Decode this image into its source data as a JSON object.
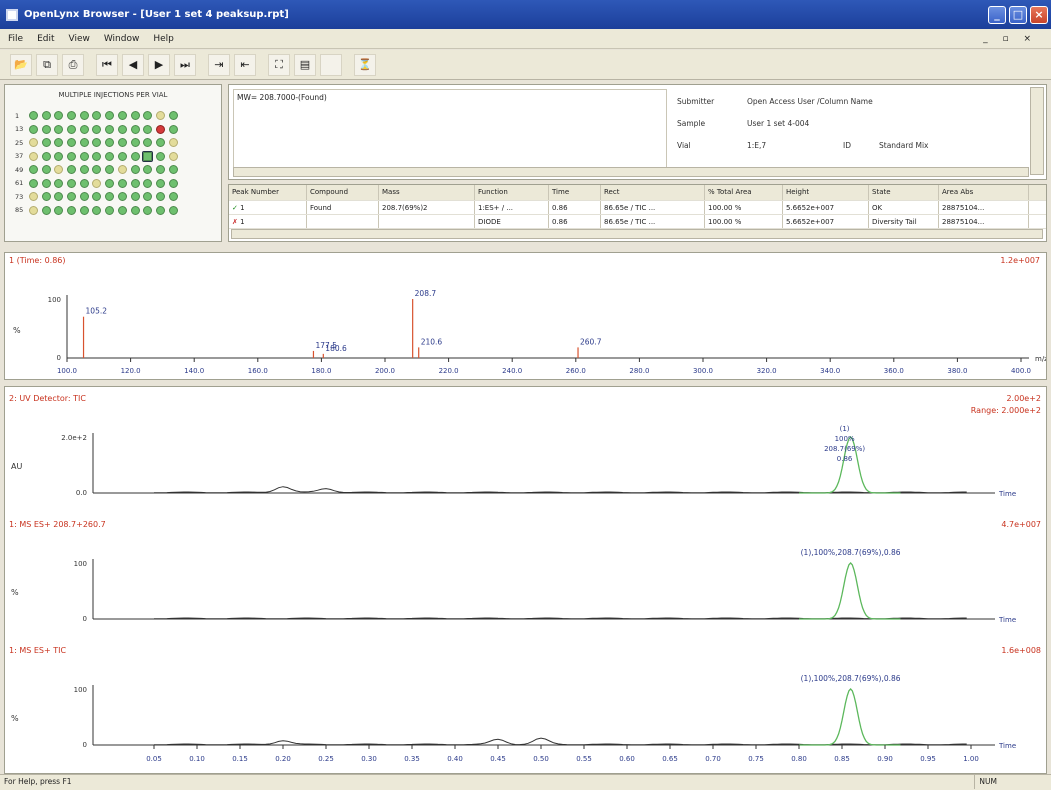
{
  "window": {
    "title": "OpenLynx Browser - [User 1 set 4 peaksup.rpt]",
    "min_glyph": "_",
    "max_glyph": "□",
    "close_glyph": "×"
  },
  "menu": {
    "items": [
      "File",
      "Edit",
      "View",
      "Window",
      "Help"
    ],
    "mdi_controls": "_ ▫ ×"
  },
  "toolbar": {
    "buttons": [
      {
        "name": "open-icon",
        "glyph": "📂"
      },
      {
        "name": "copy-icon",
        "glyph": "⧉"
      },
      {
        "name": "print-icon",
        "glyph": "⎙"
      },
      {
        "name": "first-icon",
        "glyph": "⏮"
      },
      {
        "name": "prev-icon",
        "glyph": "◀"
      },
      {
        "name": "next-icon",
        "glyph": "▶"
      },
      {
        "name": "last-icon",
        "glyph": "⏭"
      },
      {
        "name": "import-icon",
        "glyph": "⇥"
      },
      {
        "name": "export-icon",
        "glyph": "⇤"
      },
      {
        "name": "zoom-icon",
        "glyph": "⛶"
      },
      {
        "name": "layout-icon",
        "glyph": "▤"
      },
      {
        "name": "blank-icon",
        "glyph": " "
      },
      {
        "name": "filter-icon",
        "glyph": "⏳"
      }
    ]
  },
  "plate": {
    "title": "MULTIPLE INJECTIONS PER VIAL",
    "row_labels": [
      "1",
      "13",
      "25",
      "37",
      "49",
      "61",
      "73",
      "85"
    ],
    "wells": [
      [
        "g",
        "g",
        "g",
        "g",
        "g",
        "g",
        "g",
        "g",
        "g",
        "g",
        "y",
        "g"
      ],
      [
        "g",
        "g",
        "g",
        "g",
        "g",
        "g",
        "g",
        "g",
        "g",
        "g",
        "r",
        "g"
      ],
      [
        "y",
        "g",
        "g",
        "g",
        "g",
        "g",
        "g",
        "g",
        "g",
        "g",
        "g",
        "y"
      ],
      [
        "y",
        "g",
        "g",
        "g",
        "g",
        "g",
        "g",
        "g",
        "g",
        "s",
        "g",
        "y"
      ],
      [
        "g",
        "g",
        "y",
        "g",
        "g",
        "g",
        "g",
        "y",
        "g",
        "g",
        "g",
        "g"
      ],
      [
        "g",
        "g",
        "g",
        "g",
        "g",
        "y",
        "g",
        "g",
        "g",
        "g",
        "g",
        "g"
      ],
      [
        "y",
        "g",
        "g",
        "g",
        "g",
        "g",
        "g",
        "g",
        "g",
        "g",
        "g",
        "g"
      ],
      [
        "y",
        "g",
        "g",
        "g",
        "g",
        "g",
        "g",
        "g",
        "g",
        "g",
        "g",
        "g"
      ]
    ]
  },
  "info": {
    "text": "MW= 208.7000-(Found)",
    "submitter_label": "Submitter",
    "submitter_value": "Open Access User /Column Name",
    "sample_label": "Sample",
    "sample_value": "User 1 set 4-004",
    "vial_label": "Vial",
    "vial_value": "1:E,7",
    "id_label": "ID",
    "id_value": "Standard Mix"
  },
  "results": {
    "headers": [
      "Peak Number",
      "Compound",
      "Mass",
      "Function",
      "Time",
      "Rect",
      "% Total Area",
      "Height",
      "State",
      "Area Abs"
    ],
    "rows": [
      {
        "mark": "✓",
        "cells": [
          "1",
          "Found",
          "208.7(69%)2",
          "1:ES+ / ...",
          "0.86",
          "86.65e / TIC ...",
          "100.00 %",
          "5.6652e+007",
          "OK",
          "28875104..."
        ]
      },
      {
        "mark": "✗",
        "cells": [
          "1",
          "",
          "",
          "DIODE",
          "0.86",
          "86.65e / TIC ...",
          "100.00 %",
          "5.6652e+007",
          "Diversity Tail",
          "28875104..."
        ]
      }
    ]
  },
  "spectrum": {
    "title": "1 (Time: 0.86)",
    "scale": "1.2e+007",
    "y_label": "%",
    "y_top": "100",
    "y_bottom": "0",
    "x_unit": "m/z",
    "x_ticks": [
      "100.0",
      "120.0",
      "140.0",
      "160.0",
      "180.0",
      "200.0",
      "220.0",
      "240.0",
      "260.0",
      "280.0",
      "300.0",
      "320.0",
      "340.0",
      "360.0",
      "380.0",
      "400.0"
    ],
    "peaks": [
      {
        "label": "105.2",
        "mz": 105.2,
        "height": 70
      },
      {
        "label": "177.5",
        "mz": 177.5,
        "height": 12
      },
      {
        "label": "180.6",
        "mz": 180.6,
        "height": 7
      },
      {
        "label": "208.7",
        "mz": 208.7,
        "height": 100
      },
      {
        "label": "210.6",
        "mz": 210.6,
        "height": 18
      },
      {
        "label": "260.7",
        "mz": 260.7,
        "height": 18
      }
    ]
  },
  "chromatograms": {
    "time_unit": "Time",
    "x_ticks": [
      "0.05",
      "0.10",
      "0.15",
      "0.20",
      "0.25",
      "0.30",
      "0.35",
      "0.40",
      "0.45",
      "0.50",
      "0.55",
      "0.60",
      "0.65",
      "0.70",
      "0.75",
      "0.80",
      "0.85",
      "0.90",
      "0.95",
      "1.00"
    ],
    "panels": [
      {
        "title": "2: UV Detector: TIC",
        "scale_top": "2.00e+2",
        "scale_range": "Range: 2.000e+2",
        "y_top": "2.0e+2",
        "y_bottom": "0.0",
        "y_label": "AU",
        "annotation": [
          "(1)",
          "100%",
          "208.7(69%)",
          "0.86"
        ]
      },
      {
        "title": "1: MS ES+ 208.7+260.7",
        "scale_top": "4.7e+007",
        "y_top": "100",
        "y_bottom": "0",
        "y_label": "%",
        "annotation": [
          "(1),100%,208.7(69%),0.86"
        ]
      },
      {
        "title": "1: MS ES+ TIC",
        "scale_top": "1.6e+008",
        "y_top": "100",
        "y_bottom": "0",
        "y_label": "%",
        "annotation": [
          "(1),100%,208.7(69%),0.86"
        ]
      }
    ]
  },
  "status": {
    "text": "For Help, press F1",
    "num": "NUM"
  }
}
